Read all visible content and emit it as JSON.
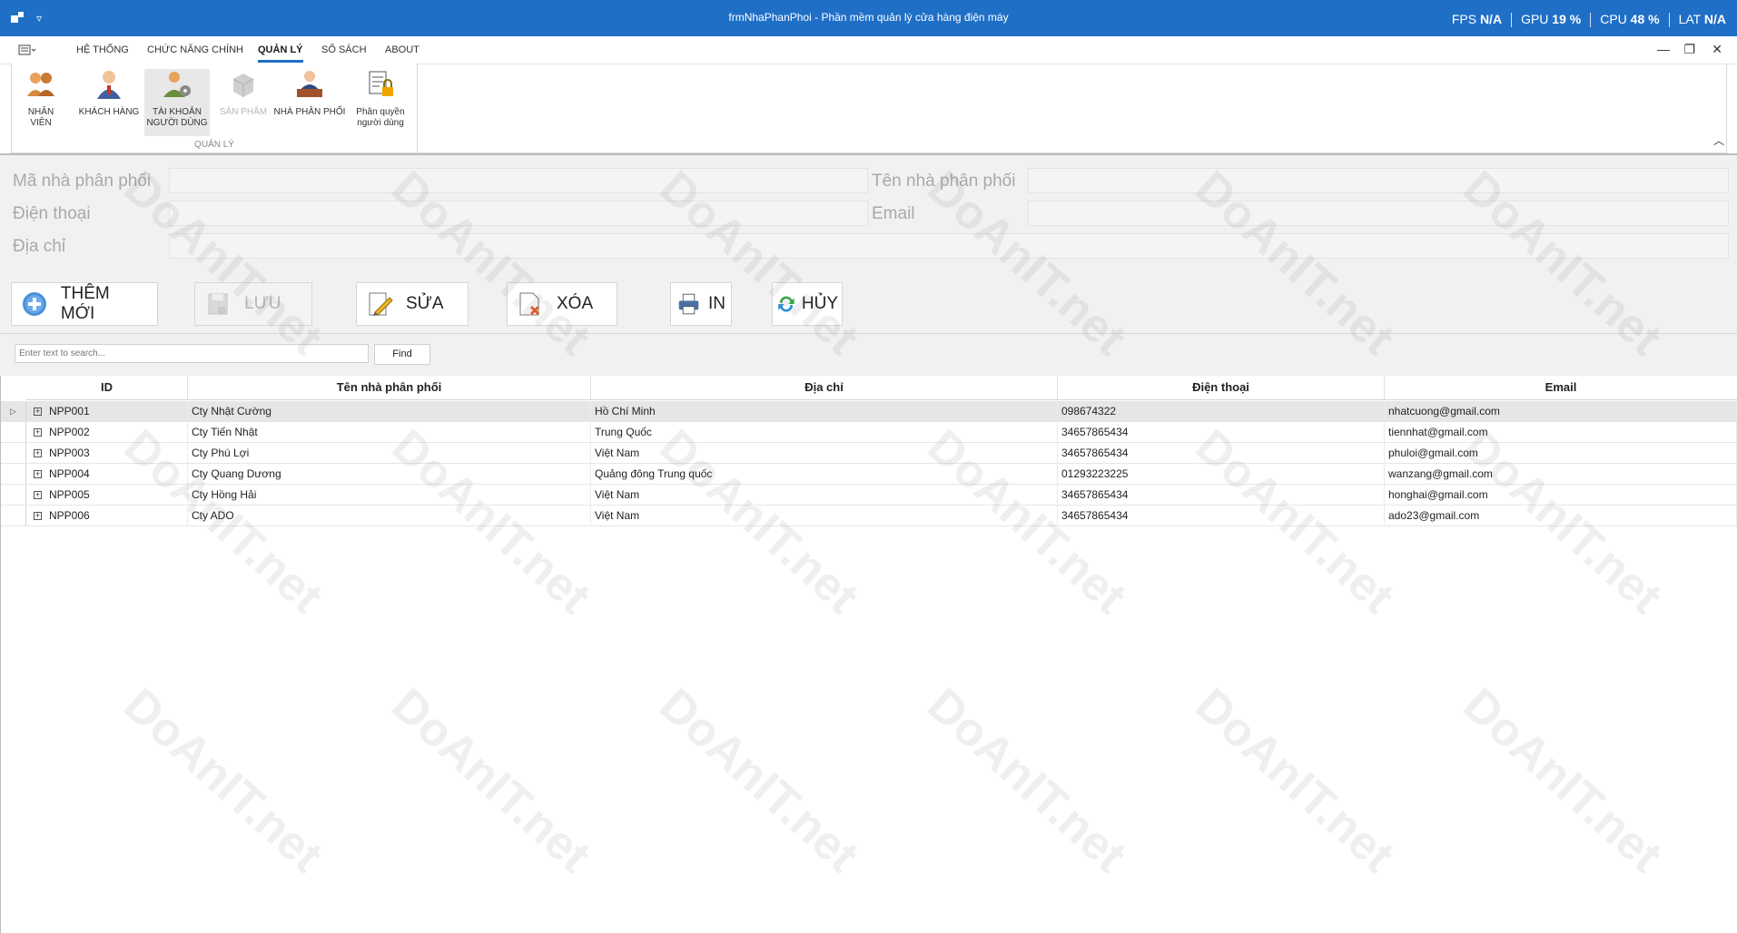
{
  "window": {
    "title": "frmNhaPhanPhoi - Phần mềm quản lý cửa hàng điện máy"
  },
  "perf": [
    {
      "label": "FPS",
      "value": "N/A"
    },
    {
      "label": "GPU",
      "value": "19 %"
    },
    {
      "label": "CPU",
      "value": "48 %"
    },
    {
      "label": "LAT",
      "value": "N/A"
    }
  ],
  "menu": {
    "items": [
      "HỆ THỐNG",
      "CHỨC NĂNG CHÍNH",
      "QUẢN LÝ",
      "SỔ SÁCH",
      "ABOUT"
    ],
    "active": "QUẢN LÝ"
  },
  "ribbon": {
    "group_label": "QUẢN LÝ",
    "buttons": [
      {
        "label": "NHÂN VIÊN",
        "icon": "employees-icon"
      },
      {
        "label": "KHÁCH HÀNG",
        "icon": "customer-icon"
      },
      {
        "label_line1": "TÀI KHOẢN",
        "label_line2": "NGƯỜI DÙNG",
        "icon": "user-account-icon"
      },
      {
        "label": "SẢN PHẨM",
        "icon": "product-box-icon"
      },
      {
        "label": "NHÀ PHÂN PHỐI",
        "icon": "distributor-icon"
      },
      {
        "label_line1": "Phân quyền",
        "label_line2": "người dùng",
        "icon": "permission-lock-icon"
      }
    ]
  },
  "form": {
    "ma_label": "Mã nhà phân phối",
    "ten_label": "Tên nhà phân phối",
    "dienthoai_label": "Điện thoại",
    "email_label": "Email",
    "diachi_label": "Địa chỉ"
  },
  "toolbar": {
    "them_moi": "THÊM MỚI",
    "luu": "LƯU",
    "sua": "SỬA",
    "xoa": "XÓA",
    "in": "IN",
    "huy": "HỦY"
  },
  "search": {
    "placeholder": "Enter text to search...",
    "find": "Find"
  },
  "grid": {
    "columns": [
      "ID",
      "Tên nhà phân phối",
      "Địa chỉ",
      "Điện thoại",
      "Email"
    ],
    "rows": [
      {
        "id": "NPP001",
        "ten": "Cty Nhật Cường",
        "diachi": "Hồ Chí Minh",
        "dienthoai": "098674322",
        "email": "nhatcuong@gmail.com"
      },
      {
        "id": "NPP002",
        "ten": "Cty Tiến Nhật",
        "diachi": "Trung Quốc",
        "dienthoai": "34657865434",
        "email": "tiennhat@gmail.com"
      },
      {
        "id": "NPP003",
        "ten": "Cty Phú Lợi",
        "diachi": "Việt Nam",
        "dienthoai": "34657865434",
        "email": "phuloi@gmail.com"
      },
      {
        "id": "NPP004",
        "ten": "Cty Quang Dương",
        "diachi": "Quảng đông Trung quốc",
        "dienthoai": "01293223225",
        "email": "wanzang@gmail.com"
      },
      {
        "id": "NPP005",
        "ten": "Cty Hồng Hải",
        "diachi": "Việt Nam",
        "dienthoai": "34657865434",
        "email": "honghai@gmail.com"
      },
      {
        "id": "NPP006",
        "ten": "Cty ADO",
        "diachi": "Việt Nam",
        "dienthoai": "34657865434",
        "email": "ado23@gmail.com"
      }
    ]
  },
  "watermark": {
    "brand": "DoAnIT.net"
  },
  "colors": {
    "titlebar": "#1f6fc7",
    "form_bg": "#f1f1f1"
  }
}
